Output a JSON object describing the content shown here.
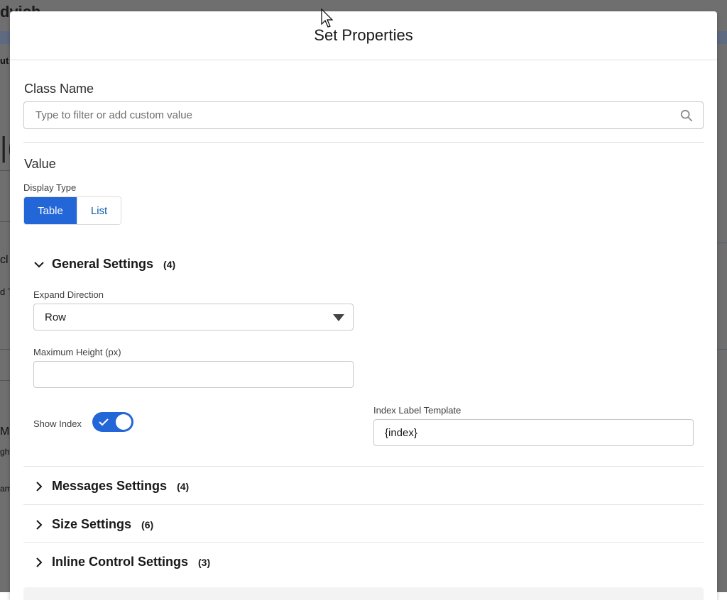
{
  "background": {
    "title_fragment": "dvich",
    "fragments": [
      "ut",
      "|(",
      "cl",
      "d T",
      "M",
      "ght",
      "am"
    ]
  },
  "modal": {
    "title": "Set Properties"
  },
  "class_name": {
    "label": "Class Name",
    "placeholder": "Type to filter or add custom value",
    "icon": "search-icon"
  },
  "value": {
    "label": "Value",
    "display_type_label": "Display Type",
    "display_types": [
      "Table",
      "List"
    ],
    "selected_display_type": "Table"
  },
  "general_settings": {
    "title": "General Settings",
    "count": "(4)",
    "expanded": true,
    "expand_direction_label": "Expand Direction",
    "expand_direction_value": "Row",
    "max_height_label": "Maximum Height (px)",
    "max_height_value": "",
    "show_index_label": "Show Index",
    "show_index_on": true,
    "index_label_template_label": "Index Label Template",
    "index_label_template_value": "{index}"
  },
  "sections": [
    {
      "title": "Messages Settings",
      "count": "(4)"
    },
    {
      "title": "Size Settings",
      "count": "(6)"
    },
    {
      "title": "Inline Control Settings",
      "count": "(3)"
    }
  ],
  "colors": {
    "brand": "#2266d8",
    "link": "#0b5cab",
    "border": "#c9c9c9"
  }
}
